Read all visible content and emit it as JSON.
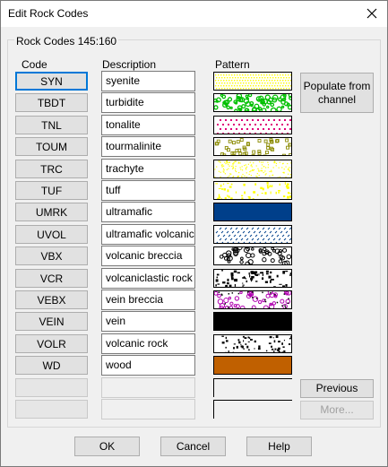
{
  "window": {
    "title": "Edit Rock Codes",
    "close_icon": "close-icon"
  },
  "group": {
    "label": "Rock Codes 145:160"
  },
  "columns": {
    "code": "Code",
    "description": "Description",
    "pattern": "Pattern"
  },
  "rows": [
    {
      "code": "SYN",
      "description": "syenite",
      "pattern": "yellow-dots",
      "selected": true
    },
    {
      "code": "TBDT",
      "description": "turbidite",
      "pattern": "green-blobs"
    },
    {
      "code": "TNL",
      "description": "tonalite",
      "pattern": "magenta-dots"
    },
    {
      "code": "TOUM",
      "description": "tourmalinite",
      "pattern": "olive-rings"
    },
    {
      "code": "TRC",
      "description": "trachyte",
      "pattern": "yellow-fine-dots"
    },
    {
      "code": "TUF",
      "description": "tuff",
      "pattern": "yellow-speckle"
    },
    {
      "code": "UMRK",
      "description": "ultramafic",
      "pattern": "solid-blue"
    },
    {
      "code": "UVOL",
      "description": "ultramafic volcanic",
      "pattern": "blue-dashes"
    },
    {
      "code": "VBX",
      "description": "volcanic breccia",
      "pattern": "black-rings"
    },
    {
      "code": "VCR",
      "description": "volcaniclastic rock",
      "pattern": "black-blotches"
    },
    {
      "code": "VEBX",
      "description": "vein breccia",
      "pattern": "purple-rings"
    },
    {
      "code": "VEIN",
      "description": "vein",
      "pattern": "solid-black"
    },
    {
      "code": "VOLR",
      "description": "volcanic rock",
      "pattern": "black-speckle"
    },
    {
      "code": "WD",
      "description": "wood",
      "pattern": "solid-brown"
    },
    {
      "code": "",
      "description": "",
      "pattern": "empty"
    },
    {
      "code": "",
      "description": "",
      "pattern": "empty"
    }
  ],
  "colors": {
    "yellow": "#ffff00",
    "green": "#00c000",
    "magenta": "#e0007a",
    "olive": "#8a8a00",
    "blue": "#003f8a",
    "navy": "#003f8a",
    "black": "#000000",
    "purple": "#b000b0",
    "brown": "#c06000"
  },
  "buttons": {
    "populate": "Populate from channel",
    "previous": "Previous",
    "more": "More...",
    "ok": "OK",
    "cancel": "Cancel",
    "help": "Help"
  }
}
